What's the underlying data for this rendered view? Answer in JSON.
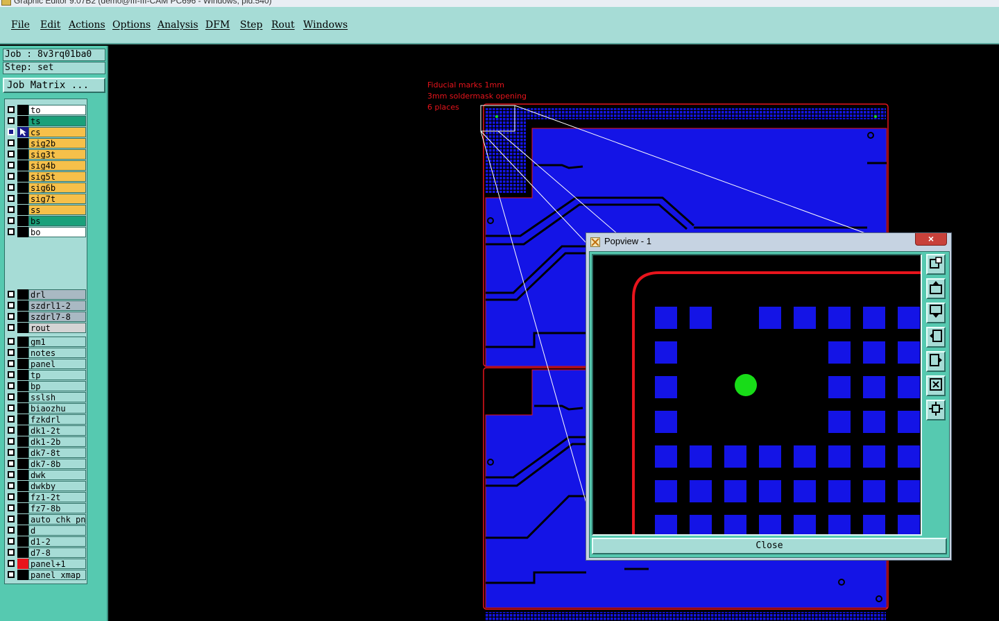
{
  "window": {
    "title": "Graphic Editor 9.07B2 (demo@III-III-CAM PC696 - Windows, pid:540)"
  },
  "menu": [
    "File",
    "Edit",
    "Actions",
    "Options",
    "Analysis",
    "DFM",
    "Step",
    "Rout",
    "Windows"
  ],
  "job": {
    "job_line": "Job : 8v3rq01ba0",
    "step_line": "Step: set",
    "matrix_button": "Job Matrix ..."
  },
  "layers": {
    "board": [
      {
        "name": "to",
        "color": "#ffffff"
      },
      {
        "name": "ts",
        "color": "#1aa07a"
      },
      {
        "name": "cs",
        "color": "#f6c04a",
        "selected": true
      },
      {
        "name": "sig2b",
        "color": "#f6c04a"
      },
      {
        "name": "sig3t",
        "color": "#f6c04a"
      },
      {
        "name": "sig4b",
        "color": "#f6c04a"
      },
      {
        "name": "sig5t",
        "color": "#f6c04a"
      },
      {
        "name": "sig6b",
        "color": "#f6c04a"
      },
      {
        "name": "sig7t",
        "color": "#f6c04a"
      },
      {
        "name": "ss",
        "color": "#f6c04a"
      },
      {
        "name": "bs",
        "color": "#1aa07a"
      },
      {
        "name": "bo",
        "color": "#ffffff"
      }
    ],
    "drill": [
      {
        "name": "drl",
        "color": "#a9b9c3"
      },
      {
        "name": "szdrl1-2",
        "color": "#a9b9c3"
      },
      {
        "name": "szdrl7-8",
        "color": "#a9b9c3"
      },
      {
        "name": "rout",
        "color": "#d4d4d4"
      }
    ],
    "misc": [
      {
        "name": "gm1",
        "color": "#a6dcd6"
      },
      {
        "name": "notes",
        "color": "#a6dcd6"
      },
      {
        "name": "panel",
        "color": "#a6dcd6"
      },
      {
        "name": "tp",
        "color": "#a6dcd6"
      },
      {
        "name": "bp",
        "color": "#a6dcd6"
      },
      {
        "name": "sslsh",
        "color": "#a6dcd6"
      },
      {
        "name": "biaozhu",
        "color": "#a6dcd6"
      },
      {
        "name": "fzkdrl",
        "color": "#a6dcd6"
      },
      {
        "name": "dk1-2t",
        "color": "#a6dcd6"
      },
      {
        "name": "dk1-2b",
        "color": "#a6dcd6"
      },
      {
        "name": "dk7-8t",
        "color": "#a6dcd6"
      },
      {
        "name": "dk7-8b",
        "color": "#a6dcd6"
      },
      {
        "name": "dwk",
        "color": "#a6dcd6"
      },
      {
        "name": "dwkby",
        "color": "#a6dcd6"
      },
      {
        "name": "fz1-2t",
        "color": "#a6dcd6"
      },
      {
        "name": "fz7-8b",
        "color": "#a6dcd6"
      },
      {
        "name": "auto_chk_pn.",
        "color": "#a6dcd6"
      },
      {
        "name": "d",
        "color": "#a6dcd6"
      },
      {
        "name": "d1-2",
        "color": "#a6dcd6"
      },
      {
        "name": "d7-8",
        "color": "#a6dcd6"
      },
      {
        "name": "panel+1",
        "color": "#a6dcd6",
        "affected_color": "#e8141c"
      },
      {
        "name": "panel_xmap",
        "color": "#a6dcd6"
      }
    ]
  },
  "canvas": {
    "annotation": [
      "Fiducial marks 1mm",
      "3mm soldermask opening",
      "6 places"
    ],
    "colors": {
      "copper": "#1414e6",
      "outline": "#e8141c",
      "fiducial": "#18dc18",
      "zoom_lines": "#ffffff"
    }
  },
  "popview": {
    "title": "Popview - 1",
    "close_x": "×",
    "close_label": "Close",
    "tools": [
      "zoom-home-icon",
      "pan-up-icon",
      "pan-down-icon",
      "pan-left-icon",
      "pan-right-icon",
      "zoom-in-icon",
      "zoom-out-icon"
    ]
  }
}
